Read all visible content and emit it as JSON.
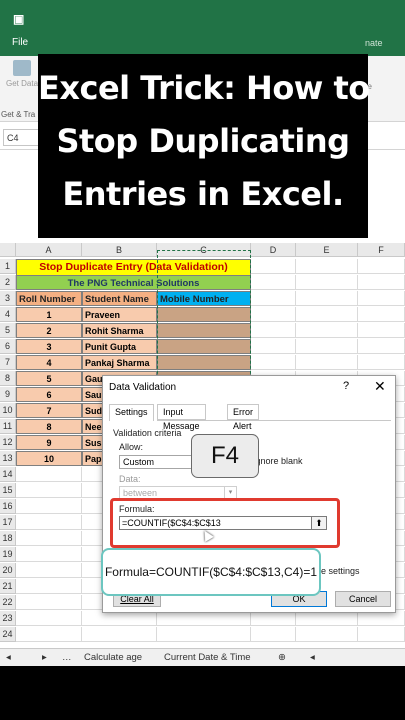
{
  "ribbon": {
    "file_tab": "File",
    "get_data": "Get Data",
    "group_label": "Get & Tra",
    "right_text": "nate",
    "right_fragment": "ne",
    "name_box": "C4"
  },
  "headline": {
    "lines": [
      "Excel Trick: How to",
      "Stop Duplicating",
      "Entries in Excel."
    ]
  },
  "sheet": {
    "columns": [
      "A",
      "B",
      "C",
      "D",
      "E",
      "F"
    ],
    "rows": [
      "1",
      "2",
      "3",
      "4",
      "5",
      "6",
      "7",
      "8",
      "9",
      "10",
      "11",
      "12",
      "13",
      "14",
      "15",
      "16",
      "17",
      "18",
      "19",
      "20",
      "21",
      "22",
      "23",
      "24"
    ],
    "title": "Stop Duplicate Entry (Data Validation)",
    "subtitle": "The PNG Technical Solutions",
    "headers": [
      "Roll Number",
      "Student Name",
      "Mobile Number"
    ],
    "students": [
      {
        "roll": "1",
        "name": "Praveen"
      },
      {
        "roll": "2",
        "name": "Rohit Sharma"
      },
      {
        "roll": "3",
        "name": "Punit Gupta"
      },
      {
        "roll": "4",
        "name": "Pankaj Sharma"
      },
      {
        "roll": "5",
        "name": "Gaurav Pandey"
      },
      {
        "roll": "6",
        "name": "Sau"
      },
      {
        "roll": "7",
        "name": "Sudh"
      },
      {
        "roll": "8",
        "name": "Nee"
      },
      {
        "roll": "9",
        "name": "Sush"
      },
      {
        "roll": "10",
        "name": "Pap"
      }
    ]
  },
  "tabs": {
    "items": [
      "Calculate age",
      "Current Date & Time"
    ]
  },
  "dialog": {
    "title": "Data Validation",
    "help": "?",
    "close": "✕",
    "tabs": [
      "Settings",
      "Input Message",
      "Error Alert"
    ],
    "criteria_label": "Validation criteria",
    "allow_label": "Allow:",
    "allow_value": "Custom",
    "ignore_blank": "Ignore blank",
    "data_label": "Data:",
    "data_value": "between",
    "formula_label": "Formula:",
    "formula_value": "=COUNTIF($C$4:$C$13",
    "apply_fragment": "e settings",
    "clear_all": "Clear All",
    "ok": "OK",
    "cancel": "Cancel"
  },
  "overlays": {
    "key_hint": "F4",
    "formula_tip": "Formula=COUNTIF($C$4:$C$13,C4)=1"
  },
  "colors": {
    "excel_green": "#217346",
    "title_yellow": "#ffff00",
    "subtitle_green": "#92d050",
    "header_peach": "#f4b083",
    "mobile_blue": "#00b0f0",
    "highlight_red": "#e03a2f",
    "tooltip_teal": "#6cc6c0"
  }
}
